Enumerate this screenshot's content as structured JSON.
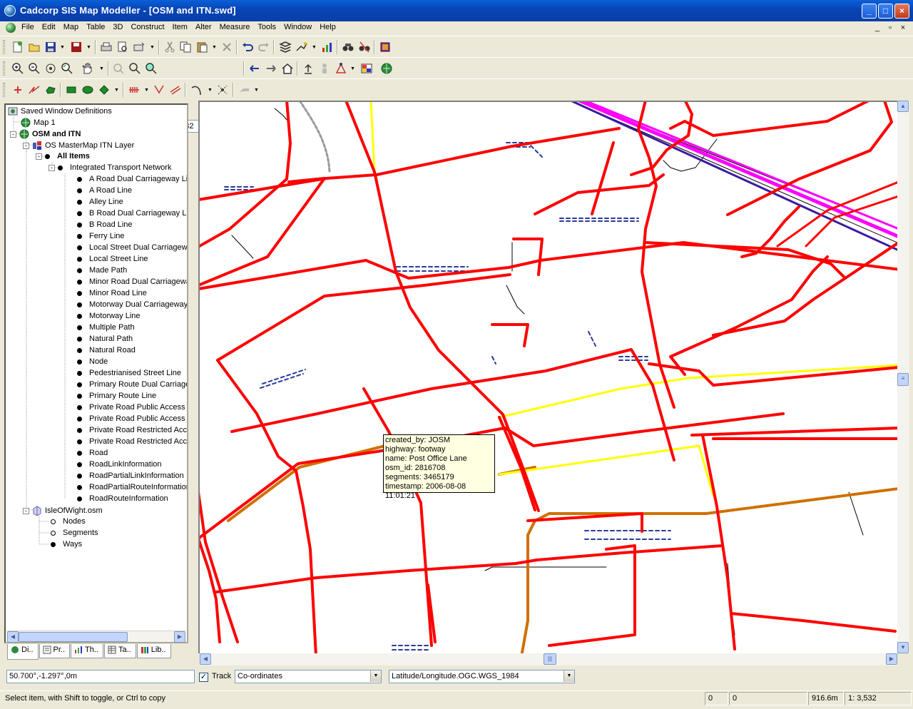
{
  "window": {
    "title": "Cadcorp SIS Map Modeller - [OSM and ITN.swd]",
    "controls": {
      "minimize": "_",
      "maximize": "□",
      "close": "×"
    }
  },
  "menu": {
    "items": [
      "File",
      "Edit",
      "Map",
      "Table",
      "3D",
      "Construct",
      "Item",
      "Alter",
      "Measure",
      "Tools",
      "Window",
      "Help"
    ],
    "mdi_controls": {
      "minimize": "_",
      "restore": "▫",
      "close": "×"
    }
  },
  "toolbar": {
    "scale_prefix": "1:",
    "scale_value": "3532"
  },
  "tree": {
    "root": "Saved Window Definitions",
    "map1": "Map 1",
    "osm_itn": "OSM and ITN",
    "itn_layer": "OS MasterMap ITN Layer",
    "all_items": "All Items",
    "itn_network": "Integrated Transport Network",
    "itn_classes": [
      "A Road Dual Carriageway Li",
      "A Road Line",
      "Alley Line",
      "B Road Dual Carriageway Li",
      "B Road Line",
      "Ferry Line",
      "Local Street Dual Carriagew",
      "Local Street Line",
      "Made Path",
      "Minor Road Dual Carriagewa",
      "Minor Road Line",
      "Motorway Dual Carriageway",
      "Motorway Line",
      "Multiple Path",
      "Natural Path",
      "Natural Road",
      "Node",
      "Pedestrianised Street Line",
      "Primary Route Dual Carriage",
      "Primary Route Line",
      "Private Road Public Access",
      "Private Road Public Access",
      "Private Road Restricted Acc",
      "Private Road Restricted Acc",
      "Road",
      "RoadLinkInformation",
      "RoadPartialLinkInformation",
      "RoadPartialRouteInformation",
      "RoadRouteInformation"
    ],
    "osm_file": "IsleOfWight.osm",
    "osm_nodes": "Nodes",
    "osm_segments": "Segments",
    "osm_ways": "Ways"
  },
  "panel_tabs": [
    "Di..",
    "Pr..",
    "Th..",
    "Ta..",
    "Lib.."
  ],
  "tooltip": {
    "lines": [
      "created_by: JOSM",
      "highway: footway",
      "name: Post Office Lane",
      "osm_id: 2816708",
      "segments: 3465179",
      "timestamp: 2006-08-08 11:01:21"
    ]
  },
  "coords": {
    "value": "50.700°,-1.297°,0m",
    "track_label": "Track",
    "track_checked": "✓",
    "mode": "Co-ordinates",
    "crs": "Latitude/Longitude.OGC.WGS_1984"
  },
  "status": {
    "hint": "Select item, with Shift to toggle, or Ctrl to copy",
    "field1": "0",
    "field2": "0",
    "distance": "916.6m",
    "scale": "1: 3,532"
  },
  "colors": {
    "road_red": "#ff0000",
    "road_yellow": "#ffff00",
    "road_orange": "#e08000",
    "motorway_magenta": "#ff00ff",
    "dash_blue": "#2a3a9a"
  }
}
